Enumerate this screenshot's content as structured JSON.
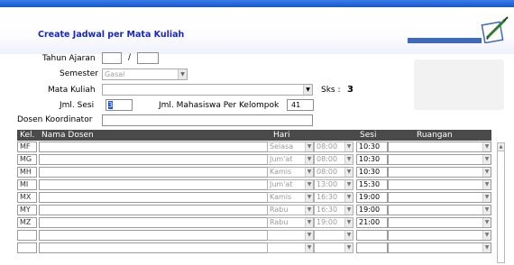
{
  "header": {
    "title": "Create Jadwal per Mata Kuliah"
  },
  "form": {
    "tahun_ajaran_label": "Tahun Ajaran",
    "tahun_ajaran_sep": "/",
    "semester_label": "Semester",
    "semester_value": "Gasal",
    "mata_kuliah_label": "Mata Kuliah",
    "sks_label": "Sks :",
    "sks_value": "3",
    "jml_sesi_label": "Jml. Sesi",
    "jml_sesi_value": "3",
    "jml_mhs_label": "Jml. Mahasiswa Per Kelompok",
    "jml_mhs_value": "41",
    "dosen_koordinator_label": "Dosen Koordinator"
  },
  "table": {
    "columns": {
      "kel": "Kel.",
      "nama_dosen": "Nama Dosen",
      "hari": "Hari",
      "sesi": "Sesi",
      "ruangan": "Ruangan"
    },
    "rows": [
      {
        "kel": "MF",
        "hari": "Selasa",
        "jam_mulai": "08:00",
        "jam_selesai": "10:30"
      },
      {
        "kel": "MG",
        "hari": "Jum'at",
        "jam_mulai": "08:00",
        "jam_selesai": "10:30"
      },
      {
        "kel": "MH",
        "hari": "Kamis",
        "jam_mulai": "08:00",
        "jam_selesai": "10:30"
      },
      {
        "kel": "MI",
        "hari": "Jum'at",
        "jam_mulai": "13:00",
        "jam_selesai": "15:30"
      },
      {
        "kel": "MX",
        "hari": "Kamis",
        "jam_mulai": "16:30",
        "jam_selesai": "19:00"
      },
      {
        "kel": "MY",
        "hari": "Rabu",
        "jam_mulai": "16:30",
        "jam_selesai": "19:00"
      },
      {
        "kel": "MZ",
        "hari": "Rabu",
        "jam_mulai": "19:00",
        "jam_selesai": "21:00"
      },
      {
        "kel": "",
        "hari": "",
        "jam_mulai": "",
        "jam_selesai": ""
      },
      {
        "kel": "",
        "hari": "",
        "jam_mulai": "",
        "jam_selesai": ""
      }
    ]
  },
  "icons": {
    "dropdown": "chevron-down-icon",
    "scroll_up": "scroll-up-arrow-icon",
    "logo": "pen-notepad-logo"
  },
  "colors": {
    "title": "#1b27b8",
    "titlebar": "#1556d4",
    "table_header": "#4a4a4a"
  }
}
